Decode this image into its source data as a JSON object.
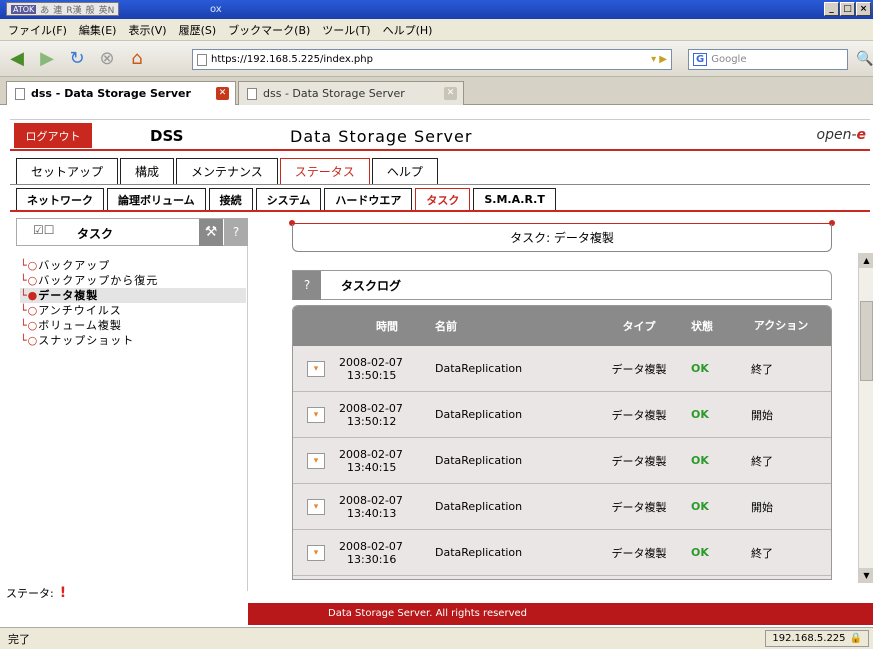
{
  "window": {
    "title": "ox",
    "ime": [
      "ATOK",
      "あ",
      "連",
      "R漢",
      "般",
      "英N"
    ]
  },
  "menu": [
    "ファイル(F)",
    "編集(E)",
    "表示(V)",
    "履歴(S)",
    "ブックマーク(B)",
    "ツール(T)",
    "ヘルプ(H)"
  ],
  "nav": {
    "url": "https://192.168.5.225/index.php",
    "search_placeholder": "Google"
  },
  "browser_tabs": [
    {
      "label": "dss - Data Storage Server",
      "active": true
    },
    {
      "label": "dss - Data Storage Server",
      "active": false
    }
  ],
  "header": {
    "logout": "ログアウト",
    "short": "DSS",
    "full": "Data Storage Server",
    "brand_prefix": "open-",
    "brand_suffix": "e"
  },
  "main_tabs": [
    "セットアップ",
    "構成",
    "メンテナンス",
    "ステータス",
    "ヘルプ"
  ],
  "main_tab_active": "ステータス",
  "sub_tabs": [
    "ネットワーク",
    "論理ボリューム",
    "接続",
    "システム",
    "ハードウエア",
    "タスク",
    "S.M.A.R.T"
  ],
  "sub_tab_active": "タスク",
  "left_panel": {
    "title": "タスク",
    "help": "?",
    "tree": [
      "バックアップ",
      "バックアップから復元",
      "データ複製",
      "アンチウイルス",
      "ボリューム複製",
      "スナップショット"
    ],
    "selected": "データ複製"
  },
  "right_panel": {
    "title": "タスク: データ複製",
    "log_title": "タスクログ",
    "help": "?",
    "columns": {
      "time": "時間",
      "name": "名前",
      "type": "タイプ",
      "state": "状態",
      "action": "アクション"
    },
    "rows": [
      {
        "date": "2008-02-07",
        "time": "13:50:15",
        "name": "DataReplication",
        "type": "データ複製",
        "state": "OK",
        "action": "終了"
      },
      {
        "date": "2008-02-07",
        "time": "13:50:12",
        "name": "DataReplication",
        "type": "データ複製",
        "state": "OK",
        "action": "開始"
      },
      {
        "date": "2008-02-07",
        "time": "13:40:15",
        "name": "DataReplication",
        "type": "データ複製",
        "state": "OK",
        "action": "終了"
      },
      {
        "date": "2008-02-07",
        "time": "13:40:13",
        "name": "DataReplication",
        "type": "データ複製",
        "state": "OK",
        "action": "開始"
      },
      {
        "date": "2008-02-07",
        "time": "13:30:16",
        "name": "DataReplication",
        "type": "データ複製",
        "state": "OK",
        "action": "終了"
      }
    ]
  },
  "status": {
    "label": "ステータ:",
    "icon": "!"
  },
  "footer": "Data Storage Server. All rights reserved",
  "browser_status": {
    "text": "完了",
    "ip": "192.168.5.225"
  },
  "colors": {
    "accent": "#c8281e",
    "ok": "#2a9a2a"
  }
}
